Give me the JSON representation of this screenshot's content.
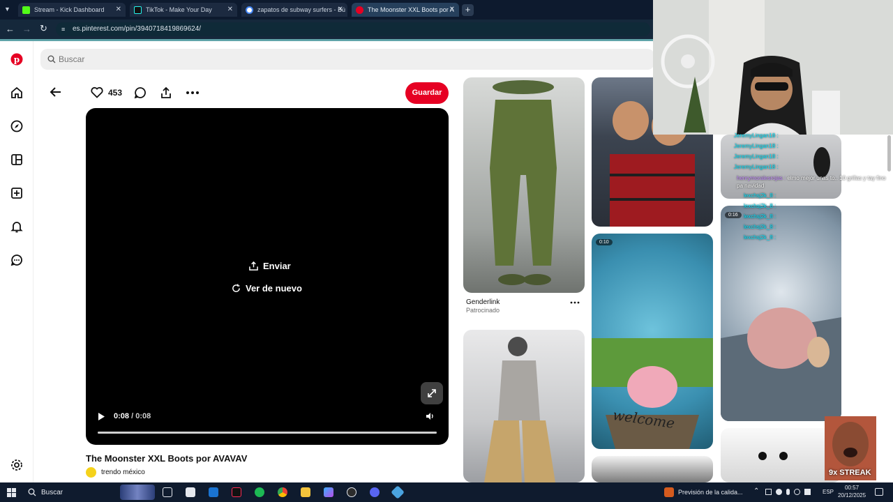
{
  "browser": {
    "tabs": [
      {
        "title": "Stream - Kick Dashboard",
        "color": "#53fc18"
      },
      {
        "title": "TikTok - Make Your Day",
        "color": "#000000"
      },
      {
        "title": "zapatos de subway surfers - Bú",
        "color": "#4285f4"
      },
      {
        "title": "The Moonster XXL Boots por A",
        "color": "#e60023"
      }
    ],
    "url": "es.pinterest.com/pin/3940718419869624/"
  },
  "search": {
    "placeholder": "Buscar"
  },
  "pin": {
    "likes": "453",
    "save_label": "Guardar",
    "send_label": "Enviar",
    "replay_label": "Ver de nuevo",
    "time_current": "0:08",
    "time_sep": " / ",
    "time_total": "0:08",
    "title": "The Moonster XXL Boots por AVAVAV",
    "author": "trendo méxico",
    "progress": 1.0
  },
  "grid": {
    "ad_title": "Genderlink",
    "ad_subtitle": "Patrocinado",
    "badge_1": "0:10",
    "badge_2": "0:16",
    "welcome_text": "welcome"
  },
  "overlay": {
    "chat_lines": [
      {
        "user": "JeremyLingan18 :",
        "msg": ""
      },
      {
        "user": "JeremyLingan18 :",
        "msg": ""
      },
      {
        "user": "JeremyLingan18 :",
        "msg": ""
      },
      {
        "user": "JeremyLingan18 :",
        "msg": ""
      },
      {
        "user": "henrymoralesrojas :",
        "msg": "elmo mejor unas to.. 10 grillas y tay fino pa navidad"
      },
      {
        "user": "lexchsj2k_8 :",
        "msg": ""
      },
      {
        "user": "lexchsj2k_8 :",
        "msg": ""
      },
      {
        "user": "lexchsj2k_8 :",
        "msg": ""
      },
      {
        "user": "lexchsj2k_8 :",
        "msg": ""
      },
      {
        "user": "lexchsj2k_8 :",
        "msg": ""
      }
    ],
    "streak": "9x STREAK"
  },
  "taskbar": {
    "search": "Buscar",
    "weather": "Previsión de la calida...",
    "lang": "ESP",
    "time": "00:57",
    "date": "20/12/2025"
  }
}
